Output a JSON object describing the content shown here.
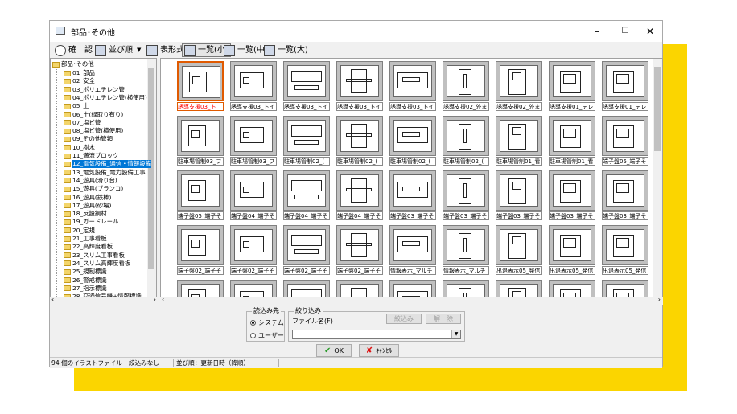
{
  "window": {
    "title": "部品･その他"
  },
  "toolbar": {
    "confirm": "確　認",
    "sort": "並び順",
    "table_view": "表形式",
    "list_small": "一覧(小)",
    "list_medium": "一覧(中)",
    "list_large": "一覧(大)"
  },
  "tree": {
    "root": "部品･その他",
    "items": [
      "01_部品",
      "02_安全",
      "03_ポリエチレン管",
      "04_ポリエチレン管(横使用)",
      "05_土",
      "06_土(緑取り有り)",
      "07_塩ビ管",
      "08_塩ビ管(横使用)",
      "09_その他管類",
      "10_樹木",
      "11_満流ブロック",
      "12_電気設備_通信・情報設備",
      "13_電気設備_電力設備工事",
      "14_遊具(滑り台)",
      "15_遊具(ブランコ)",
      "16_遊具(鉄棒)",
      "17_遊具(砂場)",
      "18_反設鋼材",
      "19_ガードレール",
      "20_定規",
      "21_工事看板",
      "22_高輝度看板",
      "23_スリム工事看板",
      "24_スリム高輝度看板",
      "25_規制標識",
      "26_警戒標識",
      "27_指示標識",
      "28_交通信号機+情報標識"
    ],
    "selected_index": 11
  },
  "thumbnails": [
    "誘導支援03_卜",
    "誘導支援03_卜イ",
    "誘導支援03_卜イ",
    "誘導支援03_卜イ",
    "誘導支援03_卜イ",
    "誘導支援02_外ま",
    "誘導支援02_外ま",
    "誘導支援01_テレ",
    "誘導支援01_テレ",
    "駐車場管制03_フ",
    "駐車場管制03_フ",
    "駐車場管制02_(",
    "駐車場管制02_(",
    "駐車場管制02_(",
    "駐車場管制02_(",
    "駐車場管制01_看",
    "駐車場管制01_看",
    "端子盤05_端子そ",
    "端子盤05_端子そ",
    "端子盤04_端子そ",
    "端子盤04_端子そ",
    "端子盤04_端子そ",
    "端子盤03_端子そ",
    "端子盤03_端子そ",
    "端子盤03_端子そ",
    "端子盤03_端子そ",
    "端子盤03_端子そ",
    "端子盤02_端子そ",
    "端子盤02_端子そ",
    "端子盤02_端子そ",
    "端子盤02_端子そ",
    "情報表示_マルチ",
    "情報表示_マルチ",
    "出退表示05_発信",
    "出退表示05_発信",
    "出退表示05_発信",
    "",
    "",
    "",
    "",
    "",
    "",
    "",
    "",
    ""
  ],
  "selected_thumbnail": 0,
  "read_source": {
    "label": "読込み先",
    "system": "システム",
    "user": "ユーザー",
    "selected": "system"
  },
  "filter": {
    "label": "絞り込み",
    "file_name_label": "ファイル名(F)",
    "apply": "絞込み",
    "clear": "解　除",
    "value": ""
  },
  "buttons": {
    "ok": "OK",
    "cancel": "ｷｬﾝｾﾙ"
  },
  "status": {
    "count": "94 個のイラストファイル",
    "filter": "絞込みなし",
    "sort": "並び順：更新日時（降順）"
  },
  "colors": {
    "accent_yellow": "#fbd500",
    "selection_blue": "#0078d7",
    "selected_border": "#e05a00",
    "selected_caption": "#ff0000"
  }
}
